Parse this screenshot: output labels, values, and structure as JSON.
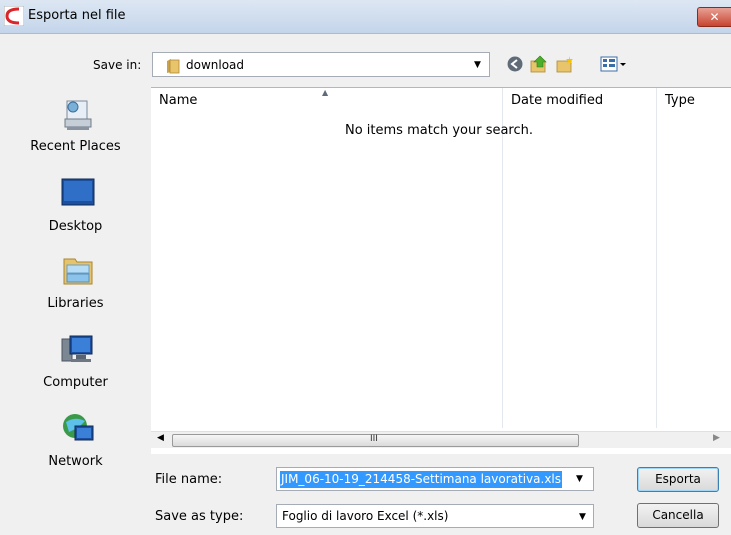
{
  "window": {
    "title": "Esporta nel file"
  },
  "toolbar": {
    "save_in_label": "Save in:",
    "save_in_value": "download",
    "icons": [
      "back-icon",
      "up-folder-icon",
      "new-folder-icon",
      "views-menu-icon"
    ]
  },
  "places": [
    {
      "label": "Recent Places",
      "icon": "recent-places-icon"
    },
    {
      "label": "Desktop",
      "icon": "desktop-icon"
    },
    {
      "label": "Libraries",
      "icon": "libraries-icon"
    },
    {
      "label": "Computer",
      "icon": "computer-icon"
    },
    {
      "label": "Network",
      "icon": "network-icon"
    }
  ],
  "filelist": {
    "columns": [
      "Name",
      "Date modified",
      "Type"
    ],
    "empty_message": "No items match your search.",
    "sort_column": "Name"
  },
  "form": {
    "file_name_label": "File name:",
    "file_name_value": "JIM_06-10-19_214458-Settimana lavorativa.xls",
    "save_as_type_label": "Save as type:",
    "save_as_type_value": "Foglio di lavoro Excel (*.xls)",
    "export_button": "Esporta",
    "cancel_button": "Cancella"
  },
  "scrollbar": {
    "grip": "III"
  },
  "colors": {
    "selection": "#3399ff",
    "close_button": "#c8442f"
  }
}
